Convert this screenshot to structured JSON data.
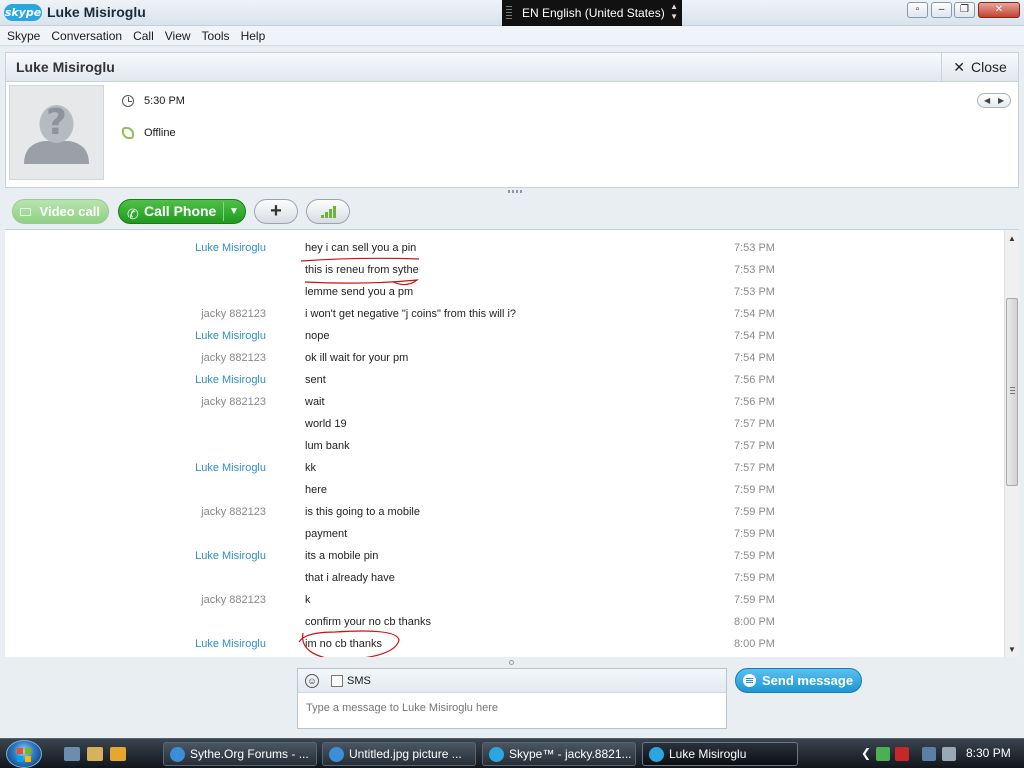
{
  "titlebar": {
    "logo": "skype",
    "title": "Luke Misiroglu"
  },
  "language_bar": {
    "text": "EN English (United States)"
  },
  "window_controls": {
    "restore": "▫",
    "minimize": "–",
    "maximize": "❐",
    "close": "✕"
  },
  "menu": [
    "Skype",
    "Conversation",
    "Call",
    "View",
    "Tools",
    "Help"
  ],
  "conversation": {
    "name": "Luke Misiroglu",
    "close_label": "Close",
    "close_icon": "close-icon"
  },
  "profile": {
    "local_time": "5:30 PM",
    "status": "Offline",
    "avatar": "unknown-avatar"
  },
  "toolbar": {
    "video_call": "Video call",
    "call_phone": "Call Phone",
    "add": "+",
    "call_quality": "call-quality-icon"
  },
  "messages": [
    {
      "sender": "Luke Misiroglu",
      "text": "hey i can sell you a pin",
      "time": "7:53 PM",
      "type": "luke"
    },
    {
      "sender": "",
      "text": "this is reneu from sythe",
      "time": "7:53 PM",
      "type": "luke"
    },
    {
      "sender": "",
      "text": "lemme send you a pm",
      "time": "7:53 PM",
      "type": "luke"
    },
    {
      "sender": "jacky 882123",
      "text": "i won't get negative \"j coins\" from this will i?",
      "time": "7:54 PM",
      "type": "jacky"
    },
    {
      "sender": "Luke Misiroglu",
      "text": "nope",
      "time": "7:54 PM",
      "type": "luke"
    },
    {
      "sender": "jacky 882123",
      "text": "ok ill wait for your pm",
      "time": "7:54 PM",
      "type": "jacky"
    },
    {
      "sender": "Luke Misiroglu",
      "text": "sent",
      "time": "7:56 PM",
      "type": "luke"
    },
    {
      "sender": "jacky 882123",
      "text": "wait",
      "time": "7:56 PM",
      "type": "jacky"
    },
    {
      "sender": "",
      "text": "world 19",
      "time": "7:57 PM",
      "type": "jacky"
    },
    {
      "sender": "",
      "text": "lum bank",
      "time": "7:57 PM",
      "type": "jacky"
    },
    {
      "sender": "Luke Misiroglu",
      "text": "kk",
      "time": "7:57 PM",
      "type": "luke"
    },
    {
      "sender": "",
      "text": "here",
      "time": "7:59 PM",
      "type": "luke"
    },
    {
      "sender": "jacky 882123",
      "text": "is this going to a mobile",
      "time": "7:59 PM",
      "type": "jacky"
    },
    {
      "sender": "",
      "text": "payment",
      "time": "7:59 PM",
      "type": "jacky"
    },
    {
      "sender": "Luke Misiroglu",
      "text": "its a mobile pin",
      "time": "7:59 PM",
      "type": "luke"
    },
    {
      "sender": "",
      "text": "that i already have",
      "time": "7:59 PM",
      "type": "luke"
    },
    {
      "sender": "jacky 882123",
      "text": "k",
      "time": "7:59 PM",
      "type": "jacky"
    },
    {
      "sender": "",
      "text": "confirm your no cb thanks",
      "time": "8:00 PM",
      "type": "jacky"
    },
    {
      "sender": "Luke Misiroglu",
      "text": "im no cb thanks",
      "time": "8:00 PM",
      "type": "luke"
    }
  ],
  "annotations": {
    "color": "#cc1111"
  },
  "input": {
    "sms_label": "SMS",
    "placeholder": "Type a message to Luke Misiroglu here"
  },
  "send_button": {
    "label": "Send message"
  },
  "taskbar": {
    "tasks": [
      {
        "label": "Sythe.Org Forums - ...",
        "icon": "ie-icon"
      },
      {
        "label": "Untitled.jpg picture ...",
        "icon": "ie-icon"
      },
      {
        "label": "Skype™ - jacky.8821...",
        "icon": "skype-icon"
      },
      {
        "label": "Luke Misiroglu",
        "icon": "skype-chat-icon"
      }
    ],
    "clock": "8:30 PM"
  },
  "colors": {
    "skype_blue": "#2aa6e0",
    "call_green": "#1f9b1d",
    "luke_name": "#2f8fc4",
    "jacky_name": "#888888"
  }
}
